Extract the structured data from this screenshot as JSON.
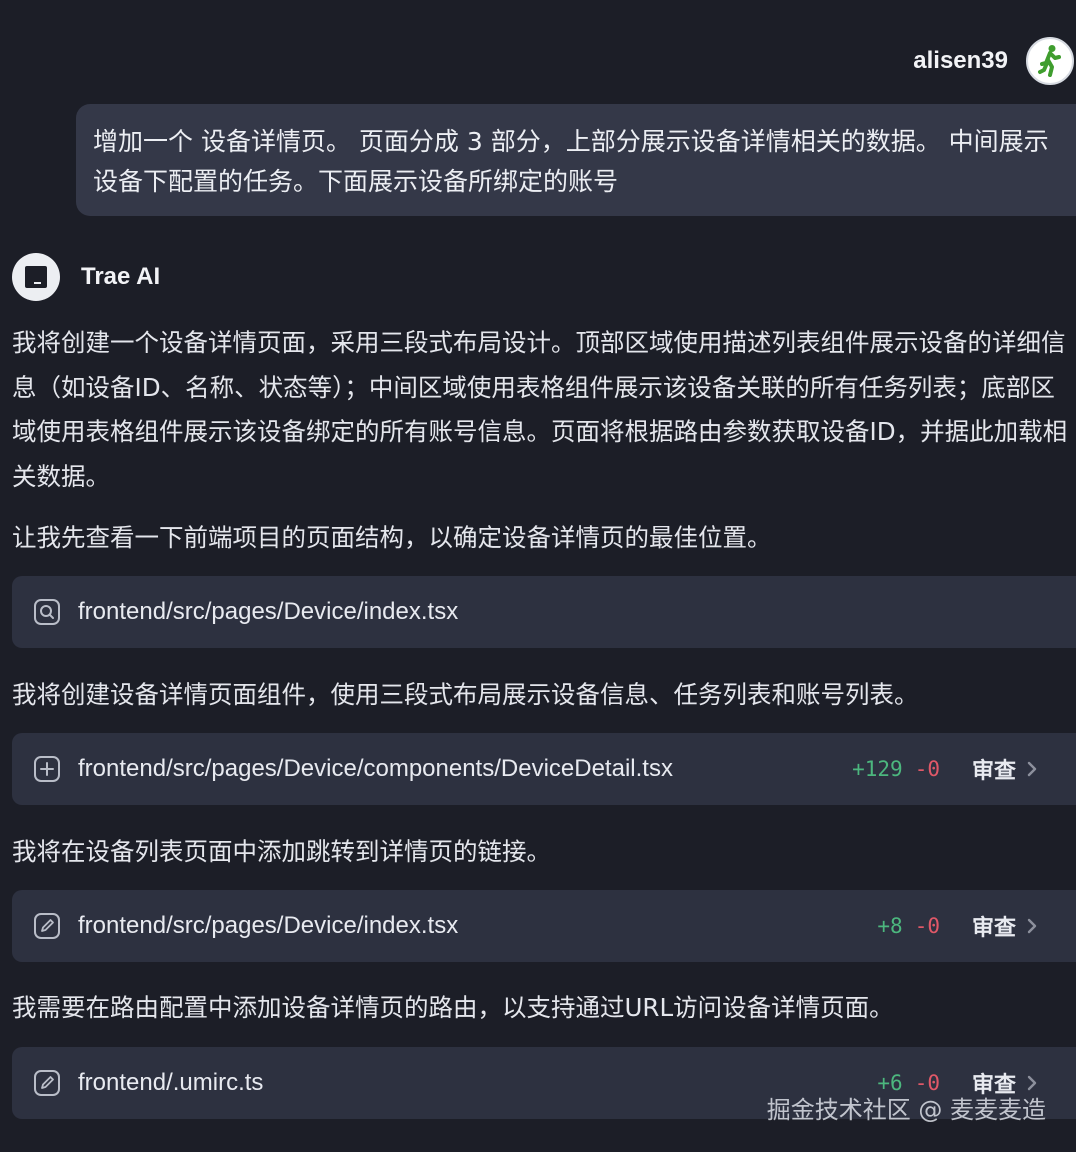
{
  "user": {
    "name": "alisen39",
    "message": "增加一个 设备详情页。 页面分成 3 部分，上部分展示设备详情相关的数据。 中间展示设备下配置的任务。下面展示设备所绑定的账号"
  },
  "assistant": {
    "name": "Trae AI",
    "paragraphs": [
      "我将创建一个设备详情页面，采用三段式布局设计。顶部区域使用描述列表组件展示设备的详细信息（如设备ID、名称、状态等）；中间区域使用表格组件展示该设备关联的所有任务列表；底部区域使用表格组件展示该设备绑定的所有账号信息。页面将根据路由参数获取设备ID，并据此加载相关数据。",
      "让我先查看一下前端项目的页面结构，以确定设备详情页的最佳位置。",
      "我将创建设备详情页面组件，使用三段式布局展示设备信息、任务列表和账号列表。",
      "我将在设备列表页面中添加跳转到详情页的链接。",
      "我需要在路由配置中添加设备详情页的路由，以支持通过URL访问设备详情页面。"
    ],
    "files": [
      {
        "icon": "search-icon",
        "path": "frontend/src/pages/Device/index.tsx"
      },
      {
        "icon": "plus-icon",
        "path": "frontend/src/pages/Device/components/DeviceDetail.tsx",
        "added": "+129",
        "removed": "-0",
        "review_label": "审查"
      },
      {
        "icon": "edit-icon",
        "path": "frontend/src/pages/Device/index.tsx",
        "added": "+8",
        "removed": "-0",
        "review_label": "审查"
      },
      {
        "icon": "edit-icon",
        "path": "frontend/.umirc.ts",
        "added": "+6",
        "removed": "-0",
        "review_label": "审查"
      }
    ]
  },
  "watermark": "掘金技术社区 @ 麦麦麦造",
  "colors": {
    "background": "#1c1e27",
    "bubble": "#343848",
    "card": "#2d3140",
    "added": "#4cb77e",
    "removed": "#e05868"
  }
}
